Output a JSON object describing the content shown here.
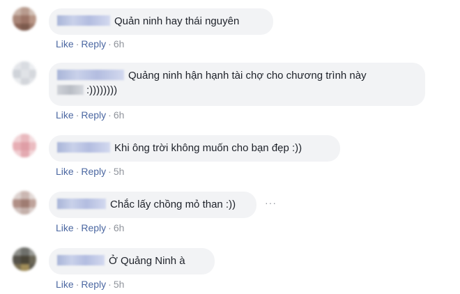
{
  "comments": [
    {
      "text": "Quản ninh hay thái nguyên",
      "like": "Like",
      "reply": "Reply",
      "time": "6h"
    },
    {
      "text_line1": "Quảng ninh hận hạnh tài chợ cho chương trình này",
      "text_line2": ":))))))))",
      "like": "Like",
      "reply": "Reply",
      "time": "6h"
    },
    {
      "text": "Khi ông trời không muốn cho bạn đẹp :))",
      "like": "Like",
      "reply": "Reply",
      "time": "5h"
    },
    {
      "text": "Chắc lấy chồng mỏ than :))",
      "like": "Like",
      "reply": "Reply",
      "time": "6h"
    },
    {
      "text": "Ở Quảng Ninh à",
      "like": "Like",
      "reply": "Reply",
      "time": "5h"
    }
  ],
  "separator": "·",
  "more_icon": "more-horizontal-icon",
  "more_glyph": "···"
}
